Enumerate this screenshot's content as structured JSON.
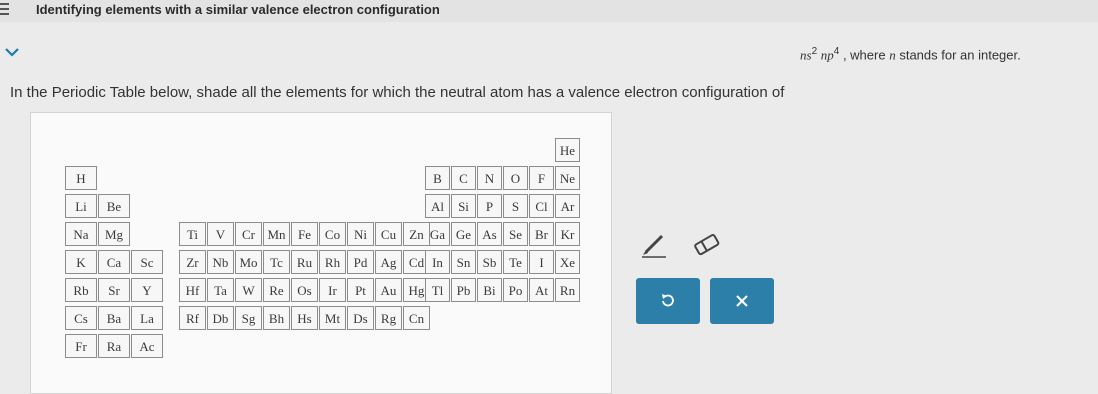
{
  "header": {
    "title": "Identifying elements with a similar valence electron configuration"
  },
  "prompt": {
    "main": "In the Periodic Table below, shade all the elements for which the neutral atom has a valence electron configuration of",
    "config_n1": "n",
    "config_s": "s",
    "config_s_exp": "2",
    "config_n2": "n",
    "config_p": "p",
    "config_p_exp": "4",
    "config_tail": ", where",
    "config_n3": "n",
    "config_end": "stands for an integer."
  },
  "periodic_table": {
    "cells": [
      {
        "sym": "He",
        "r": 0,
        "c": 17
      },
      {
        "sym": "H",
        "r": 1,
        "c": 0
      },
      {
        "sym": "B",
        "r": 1,
        "c": 12
      },
      {
        "sym": "C",
        "r": 1,
        "c": 13
      },
      {
        "sym": "N",
        "r": 1,
        "c": 14
      },
      {
        "sym": "O",
        "r": 1,
        "c": 15
      },
      {
        "sym": "F",
        "r": 1,
        "c": 16
      },
      {
        "sym": "Ne",
        "r": 1,
        "c": 17
      },
      {
        "sym": "Li",
        "r": 2,
        "c": 0
      },
      {
        "sym": "Be",
        "r": 2,
        "c": 1
      },
      {
        "sym": "Al",
        "r": 2,
        "c": 12
      },
      {
        "sym": "Si",
        "r": 2,
        "c": 13
      },
      {
        "sym": "P",
        "r": 2,
        "c": 14
      },
      {
        "sym": "S",
        "r": 2,
        "c": 15
      },
      {
        "sym": "Cl",
        "r": 2,
        "c": 16
      },
      {
        "sym": "Ar",
        "r": 2,
        "c": 17
      },
      {
        "sym": "Na",
        "r": 3,
        "c": 0
      },
      {
        "sym": "Mg",
        "r": 3,
        "c": 1
      },
      {
        "sym": "Ga",
        "r": 3,
        "c": 12
      },
      {
        "sym": "Ge",
        "r": 3,
        "c": 13
      },
      {
        "sym": "As",
        "r": 3,
        "c": 14
      },
      {
        "sym": "Se",
        "r": 3,
        "c": 15
      },
      {
        "sym": "Br",
        "r": 3,
        "c": 16
      },
      {
        "sym": "Kr",
        "r": 3,
        "c": 17
      },
      {
        "sym": "Ti",
        "r": 3,
        "c": 3
      },
      {
        "sym": "V",
        "r": 3,
        "c": 4
      },
      {
        "sym": "Cr",
        "r": 3,
        "c": 5
      },
      {
        "sym": "Mn",
        "r": 3,
        "c": 6
      },
      {
        "sym": "Fe",
        "r": 3,
        "c": 7
      },
      {
        "sym": "Co",
        "r": 3,
        "c": 8
      },
      {
        "sym": "Ni",
        "r": 3,
        "c": 9
      },
      {
        "sym": "Cu",
        "r": 3,
        "c": 10
      },
      {
        "sym": "Zn",
        "r": 3,
        "c": 11
      },
      {
        "sym": "K",
        "r": 4,
        "c": 0
      },
      {
        "sym": "Ca",
        "r": 4,
        "c": 1
      },
      {
        "sym": "Sc",
        "r": 4,
        "c": 2
      },
      {
        "sym": "Zr",
        "r": 4,
        "c": 3
      },
      {
        "sym": "Nb",
        "r": 4,
        "c": 4
      },
      {
        "sym": "Mo",
        "r": 4,
        "c": 5
      },
      {
        "sym": "Tc",
        "r": 4,
        "c": 6
      },
      {
        "sym": "Ru",
        "r": 4,
        "c": 7
      },
      {
        "sym": "Rh",
        "r": 4,
        "c": 8
      },
      {
        "sym": "Pd",
        "r": 4,
        "c": 9
      },
      {
        "sym": "Ag",
        "r": 4,
        "c": 10
      },
      {
        "sym": "Cd",
        "r": 4,
        "c": 11
      },
      {
        "sym": "In",
        "r": 4,
        "c": 12
      },
      {
        "sym": "Sn",
        "r": 4,
        "c": 13
      },
      {
        "sym": "Sb",
        "r": 4,
        "c": 14
      },
      {
        "sym": "Te",
        "r": 4,
        "c": 15
      },
      {
        "sym": "I",
        "r": 4,
        "c": 16
      },
      {
        "sym": "Xe",
        "r": 4,
        "c": 17
      },
      {
        "sym": "Rb",
        "r": 5,
        "c": 0
      },
      {
        "sym": "Sr",
        "r": 5,
        "c": 1
      },
      {
        "sym": "Y",
        "r": 5,
        "c": 2
      },
      {
        "sym": "Hf",
        "r": 5,
        "c": 3
      },
      {
        "sym": "Ta",
        "r": 5,
        "c": 4
      },
      {
        "sym": "W",
        "r": 5,
        "c": 5
      },
      {
        "sym": "Re",
        "r": 5,
        "c": 6
      },
      {
        "sym": "Os",
        "r": 5,
        "c": 7
      },
      {
        "sym": "Ir",
        "r": 5,
        "c": 8
      },
      {
        "sym": "Pt",
        "r": 5,
        "c": 9
      },
      {
        "sym": "Au",
        "r": 5,
        "c": 10
      },
      {
        "sym": "Hg",
        "r": 5,
        "c": 11
      },
      {
        "sym": "Tl",
        "r": 5,
        "c": 12
      },
      {
        "sym": "Pb",
        "r": 5,
        "c": 13
      },
      {
        "sym": "Bi",
        "r": 5,
        "c": 14
      },
      {
        "sym": "Po",
        "r": 5,
        "c": 15
      },
      {
        "sym": "At",
        "r": 5,
        "c": 16
      },
      {
        "sym": "Rn",
        "r": 5,
        "c": 17
      },
      {
        "sym": "Cs",
        "r": 6,
        "c": 0
      },
      {
        "sym": "Ba",
        "r": 6,
        "c": 1
      },
      {
        "sym": "La",
        "r": 6,
        "c": 2
      },
      {
        "sym": "Rf",
        "r": 6,
        "c": 3
      },
      {
        "sym": "Db",
        "r": 6,
        "c": 4
      },
      {
        "sym": "Sg",
        "r": 6,
        "c": 5
      },
      {
        "sym": "Bh",
        "r": 6,
        "c": 6
      },
      {
        "sym": "Hs",
        "r": 6,
        "c": 7
      },
      {
        "sym": "Mt",
        "r": 6,
        "c": 8
      },
      {
        "sym": "Ds",
        "r": 6,
        "c": 9
      },
      {
        "sym": "Rg",
        "r": 6,
        "c": 10
      },
      {
        "sym": "Cn",
        "r": 6,
        "c": 11
      },
      {
        "sym": "Fr",
        "r": 7,
        "c": 0
      },
      {
        "sym": "Ra",
        "r": 7,
        "c": 1
      },
      {
        "sym": "Ac",
        "r": 7,
        "c": 2
      }
    ]
  },
  "tools": {
    "draw_icon": "pencil-icon",
    "erase_icon": "eraser-icon",
    "undo_icon": "undo-icon",
    "clear_icon": "close-icon"
  },
  "colors": {
    "button": "#2b7fa8",
    "cell_border": "#8c8c8c"
  }
}
